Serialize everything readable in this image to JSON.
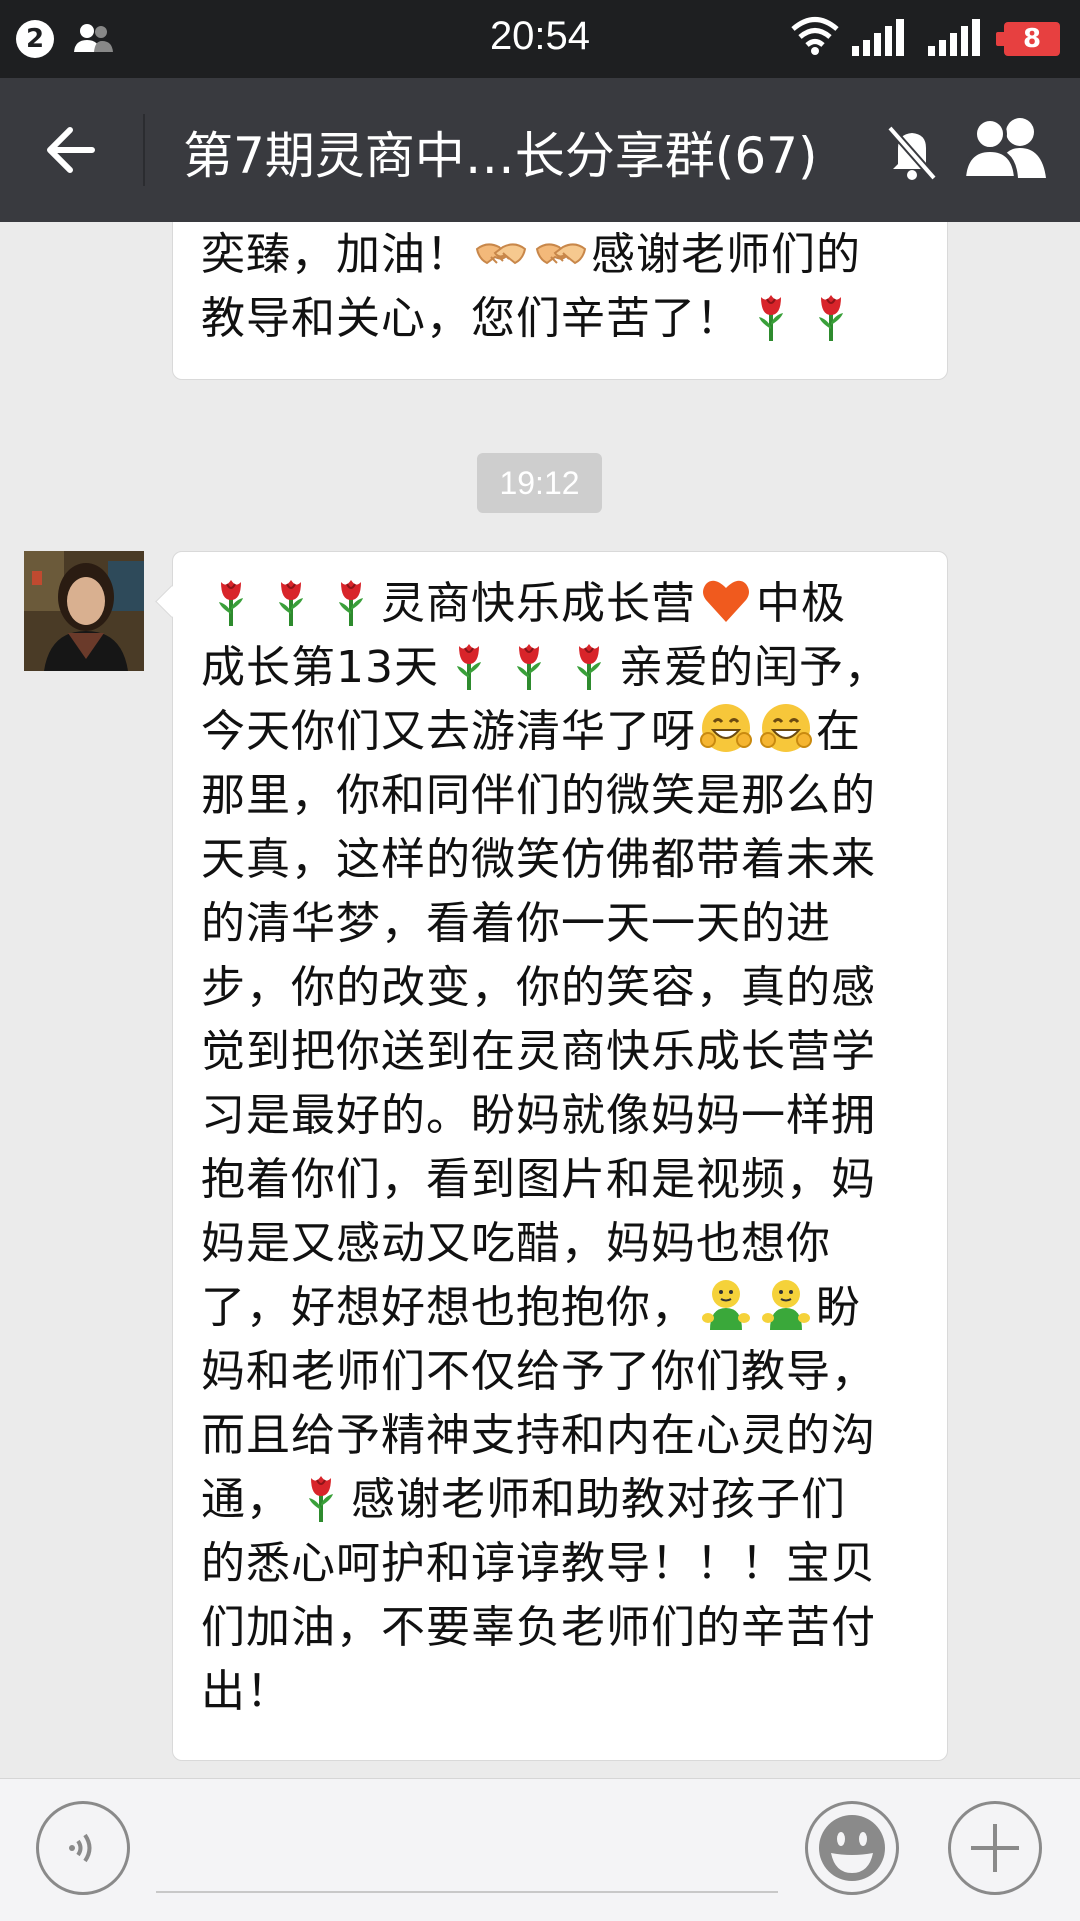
{
  "status_bar": {
    "notification_count": "2",
    "time": "20:54",
    "battery": "8",
    "icons": [
      "contacts-icon",
      "wifi-icon",
      "signal-icon",
      "battery-icon"
    ]
  },
  "header": {
    "title": "第7期灵商中…长分享群(67)",
    "icons": [
      "back-arrow-icon",
      "mute-bell-icon",
      "group-members-icon"
    ]
  },
  "messages": [
    {
      "type": "text",
      "lines": [
        [
          {
            "t": "奕臻，加油！"
          },
          {
            "e": "handshake"
          },
          {
            "e": "handshake"
          },
          {
            "t": "感谢老师们的"
          }
        ],
        [
          {
            "t": "教导和关心，您们辛苦了！"
          },
          {
            "e": "rose"
          },
          {
            "e": "rose"
          }
        ]
      ]
    },
    {
      "type": "time",
      "text": "19:12"
    },
    {
      "type": "text",
      "lines": [
        [
          {
            "e": "rose"
          },
          {
            "e": "rose"
          },
          {
            "e": "rose"
          },
          {
            "t": "灵商快乐成长营"
          },
          {
            "e": "heart"
          },
          {
            "t": "中极"
          }
        ],
        [
          {
            "t": "成长第13天"
          },
          {
            "e": "rose"
          },
          {
            "e": "rose"
          },
          {
            "e": "rose"
          },
          {
            "t": "亲爱的闰予，"
          }
        ],
        [
          {
            "t": "今天你们又去游清华了呀"
          },
          {
            "e": "grin"
          },
          {
            "e": "grin"
          },
          {
            "t": "在"
          }
        ],
        [
          {
            "t": "那里，你和同伴们的微笑是那么的"
          }
        ],
        [
          {
            "t": "天真，这样的微笑仿佛都带着未来"
          }
        ],
        [
          {
            "t": "的清华梦，看着你一天一天的进"
          }
        ],
        [
          {
            "t": "步，你的改变，你的笑容，真的感"
          }
        ],
        [
          {
            "t": "觉到把你送到在灵商快乐成长营学"
          }
        ],
        [
          {
            "t": "习是最好的。盼妈就像妈妈一样拥"
          }
        ],
        [
          {
            "t": "抱着你们，看到图片和是视频，妈"
          }
        ],
        [
          {
            "t": "妈是又感动又吃醋，妈妈也想你"
          }
        ],
        [
          {
            "t": "了，好想好想也抱抱你，"
          },
          {
            "e": "hug"
          },
          {
            "e": "hug"
          },
          {
            "t": "盼"
          }
        ],
        [
          {
            "t": "妈和老师们不仅给予了你们教导，"
          }
        ],
        [
          {
            "t": "而且给予精神支持和内在心灵的沟"
          }
        ],
        [
          {
            "t": "通，"
          },
          {
            "e": "rose"
          },
          {
            "t": "感谢老师和助教对孩子们"
          }
        ],
        [
          {
            "t": "的悉心呵护和谆谆教导！！！宝贝"
          }
        ],
        [
          {
            "t": "们加油，不要辜负老师们的辛苦付"
          }
        ],
        [
          {
            "t": "出！"
          }
        ]
      ]
    }
  ],
  "input_bar": {
    "placeholder": "",
    "icons": [
      "voice-icon",
      "emoji-icon",
      "plus-icon"
    ]
  }
}
